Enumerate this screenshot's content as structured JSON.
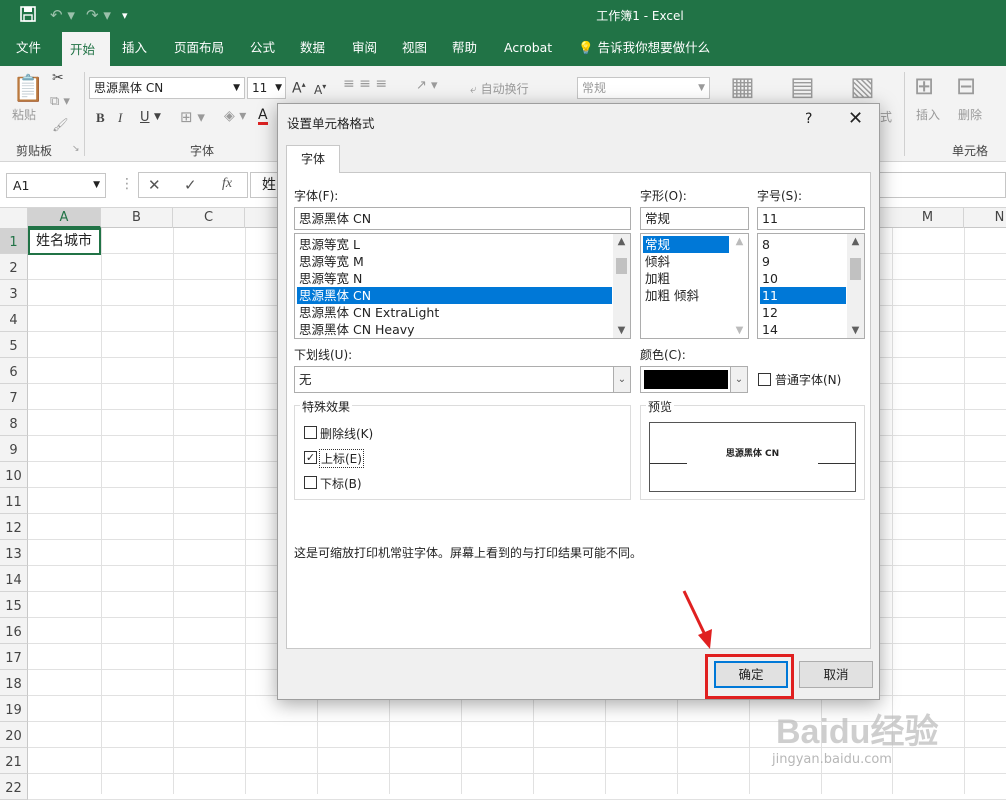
{
  "titlebar": {
    "title": "工作簿1  -  Excel",
    "save_icon": "save-icon",
    "undo_icon": "undo-icon",
    "redo_icon": "redo-icon"
  },
  "tabs": [
    "文件",
    "开始",
    "插入",
    "页面布局",
    "公式",
    "数据",
    "审阅",
    "视图",
    "帮助",
    "Acrobat"
  ],
  "tell_me": "告诉我你想要做什么",
  "ribbon": {
    "paste": "粘贴",
    "clipboard": "剪贴板",
    "font_name": "思源黑体 CN",
    "font_size": "11",
    "bold": "B",
    "italic": "I",
    "underline": "U",
    "font_group": "字体",
    "wrap_text": "自动换行",
    "number_format": "常规",
    "insert": "插入",
    "delete": "删除",
    "format_partial": "式",
    "cells_group": "单元格"
  },
  "formula_bar": {
    "name_box": "A1",
    "fx": "fx",
    "content_partial": "姓"
  },
  "grid": {
    "columns": [
      "A",
      "B",
      "C",
      "M",
      "N"
    ],
    "rows": [
      "1",
      "2",
      "3",
      "4",
      "5",
      "6",
      "7",
      "8",
      "9",
      "10",
      "11",
      "12",
      "13",
      "14",
      "15",
      "16",
      "17",
      "18",
      "19",
      "20",
      "21",
      "22"
    ],
    "a1_value": "姓名城市"
  },
  "dialog": {
    "title": "设置单元格格式",
    "help": "?",
    "close": "✕",
    "tab": "字体",
    "font_label": "字体(F):",
    "font_value": "思源黑体 CN",
    "font_list": [
      "思源等宽 L",
      "思源等宽 M",
      "思源等宽 N",
      "思源黑体 CN",
      "思源黑体 CN ExtraLight",
      "思源黑体 CN Heavy"
    ],
    "font_selected_index": 3,
    "style_label": "字形(O):",
    "style_value": "常规",
    "style_list": [
      "常规",
      "倾斜",
      "加粗",
      "加粗 倾斜"
    ],
    "style_selected_index": 0,
    "size_label": "字号(S):",
    "size_value": "11",
    "size_list": [
      "8",
      "9",
      "10",
      "11",
      "12",
      "14"
    ],
    "size_selected_index": 3,
    "underline_label": "下划线(U):",
    "underline_value": "无",
    "color_label": "颜色(C):",
    "color_value": "#000000",
    "normal_font_label": "普通字体(N)",
    "effects_label": "特殊效果",
    "strikethrough": "删除线(K)",
    "superscript": "上标(E)",
    "subscript": "下标(B)",
    "superscript_checked": true,
    "preview_label": "预览",
    "preview_text": "思源黑体 CN",
    "note": "这是可缩放打印机常驻字体。屏幕上看到的与打印结果可能不同。",
    "ok": "确定",
    "cancel": "取消"
  },
  "watermark": {
    "logo": "Baidu经验",
    "url": "jingyan.baidu.com"
  },
  "accent_colors": {
    "excel_green": "#217346",
    "selection_blue": "#0078d7",
    "highlight_red": "#e02020"
  }
}
